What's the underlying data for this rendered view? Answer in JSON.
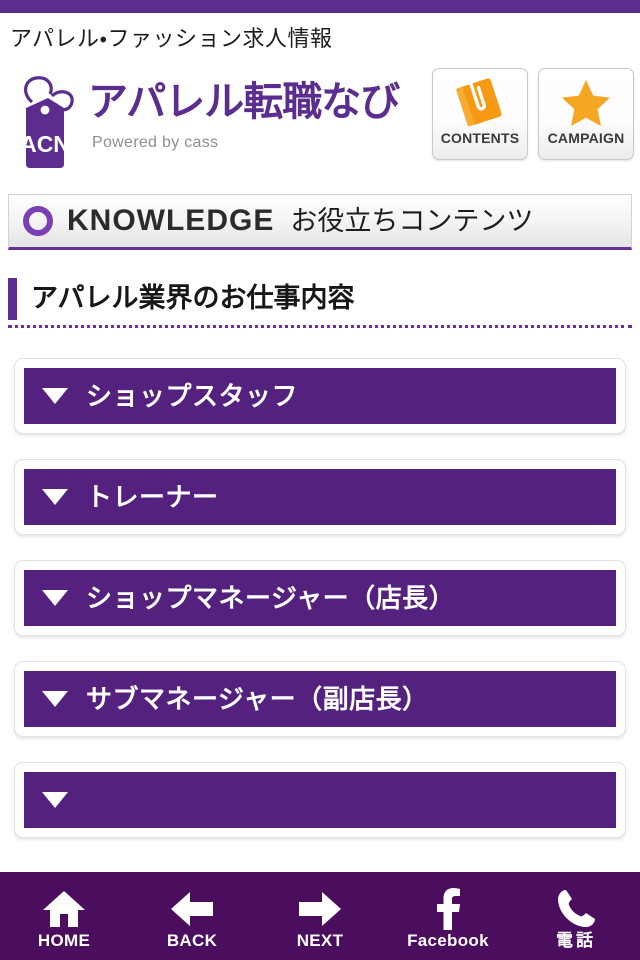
{
  "statusbar": {
    "color": "#5b2d8e"
  },
  "tagline": "アパレル・ファッション求人情報",
  "logo": {
    "tag_text": "ACN",
    "wordmark": "アパレル転職なび",
    "powered_by": "Powered by cass",
    "brand_color": "#5b2d8e"
  },
  "header_buttons": [
    {
      "label": "Contents",
      "icon": "book-clip-icon",
      "icon_color": "#f59a12"
    },
    {
      "label": "Campaign",
      "icon": "star-icon",
      "icon_color": "#f5a623"
    }
  ],
  "knowledge_banner": {
    "icon": "circle-ring-icon",
    "title_en": "Knowledge",
    "title_jp": "お役立ちコンテンツ",
    "accent_color": "#6b2f9c"
  },
  "section": {
    "title": "アパレル業界のお仕事内容",
    "accent_color": "#5b2d8e"
  },
  "accordion": {
    "marker_icon": "triangle-down-icon",
    "bar_color": "#54217f",
    "items": [
      {
        "label": "ショップスタッフ"
      },
      {
        "label": "トレーナー"
      },
      {
        "label": "ショップマネージャー（店長）"
      },
      {
        "label": "サブマネージャー（副店長）"
      },
      {
        "label": ""
      }
    ]
  },
  "bottom_nav": {
    "background": "#4b0d5e",
    "items": [
      {
        "label": "HOME",
        "icon": "home-icon"
      },
      {
        "label": "BACK",
        "icon": "arrow-left-icon"
      },
      {
        "label": "NEXT",
        "icon": "arrow-right-icon"
      },
      {
        "label": "Facebook",
        "icon": "facebook-icon"
      },
      {
        "label": "電話",
        "icon": "phone-icon"
      }
    ]
  }
}
